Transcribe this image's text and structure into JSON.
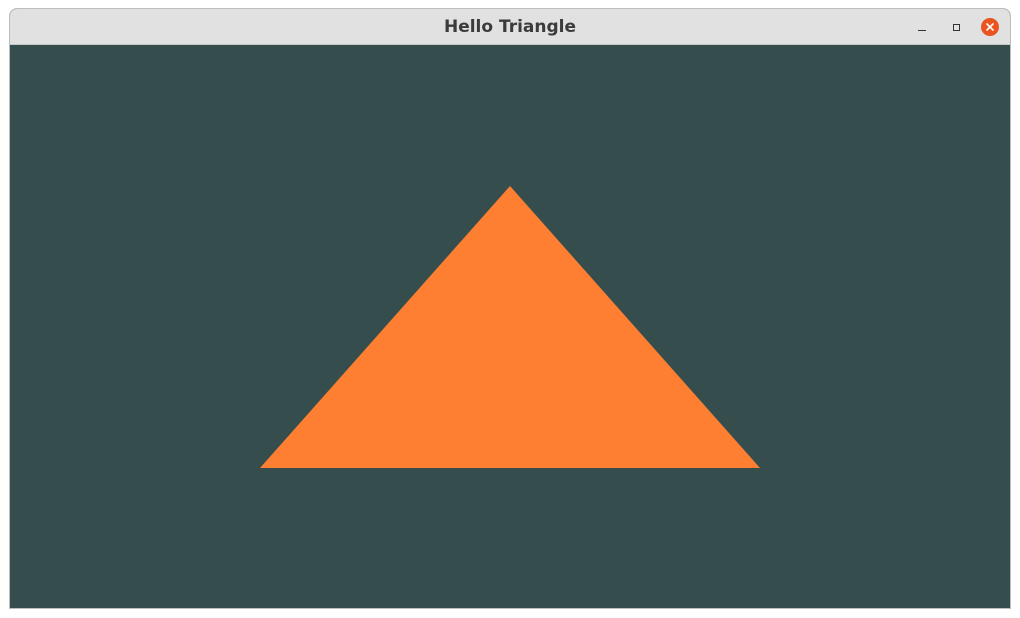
{
  "window": {
    "title": "Hello Triangle",
    "controls": {
      "minimize_icon": "minimize-icon",
      "maximize_icon": "maximize-icon",
      "close_icon": "close-icon",
      "close_color": "#e95420"
    }
  },
  "scene": {
    "clear_color": "#354e4d",
    "triangle_color": "#fe7f31",
    "triangle_vertices_ndc": [
      [
        -0.5,
        -0.5
      ],
      [
        0.5,
        -0.5
      ],
      [
        0.0,
        0.5
      ]
    ]
  }
}
